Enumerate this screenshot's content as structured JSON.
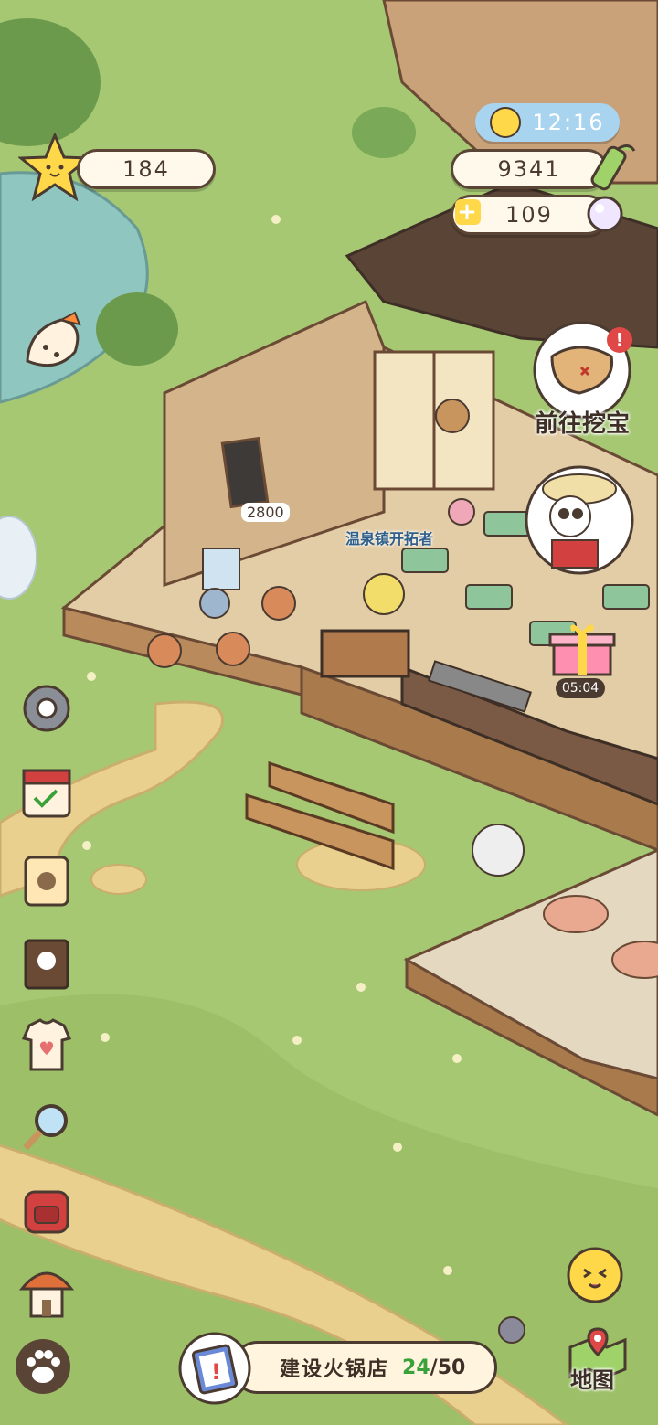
{
  "hud": {
    "stars": "184",
    "time": "12:16",
    "bamboo": "9341",
    "pearls": "109"
  },
  "treasure": {
    "label": "前往挖宝"
  },
  "gift": {
    "timer": "05:04"
  },
  "shop": {
    "price": "2800",
    "npc_title": "温泉镇开拓者"
  },
  "task": {
    "name": "建设火锅店",
    "current": "24",
    "separator": "/",
    "total": "50"
  },
  "map": {
    "label": "地图"
  },
  "colors": {
    "grass": "#9fc36a",
    "wood": "#c9a27a",
    "outline": "#4a3a30",
    "accent_green": "#3aa23a"
  }
}
